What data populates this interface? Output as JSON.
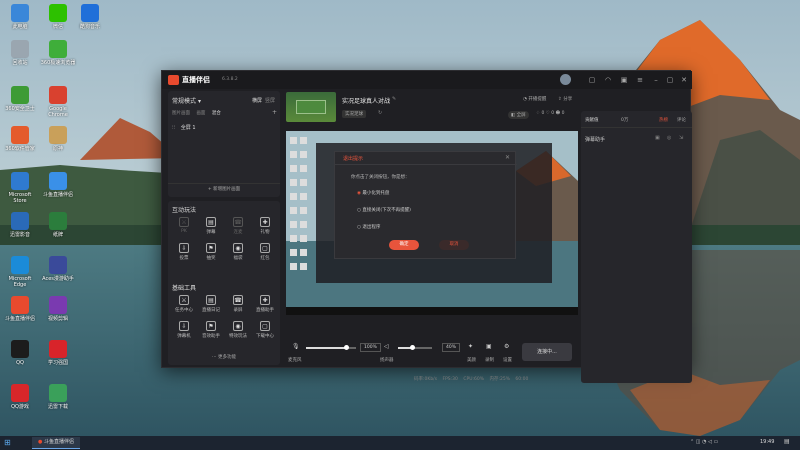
{
  "desktop": {
    "icons": [
      {
        "label": "此电脑",
        "icon": "computer-icon",
        "color": "#3a87d9"
      },
      {
        "label": "微信",
        "icon": "wechat-icon",
        "color": "#2dc100"
      },
      {
        "label": "酷狗音乐",
        "icon": "kugou-icon",
        "color": "#1f6fd9"
      },
      {
        "label": "回收站",
        "icon": "recycle-bin-icon",
        "color": "#9aa6b0"
      },
      {
        "label": "360极速浏览器",
        "icon": "browser-icon",
        "color": "#3fae3a"
      },
      {
        "label": "360安全卫士",
        "icon": "shield-icon",
        "color": "#3d9b35"
      },
      {
        "label": "Google Chrome",
        "icon": "chrome-icon",
        "color": "#d9412f"
      },
      {
        "label": "360软件管家",
        "icon": "store-icon",
        "color": "#e45b2c"
      },
      {
        "label": "原神",
        "icon": "game-icon",
        "color": "#c9a05a"
      },
      {
        "label": "Microsoft Store",
        "icon": "ms-store-icon",
        "color": "#2f7ad0"
      },
      {
        "label": "斗鱼直播伴侣",
        "icon": "douyu-icon",
        "color": "#3a90e8"
      },
      {
        "label": "迅雷影音",
        "icon": "player-icon",
        "color": "#2a6ab8"
      },
      {
        "label": "纸牌",
        "icon": "cards-icon",
        "color": "#2b7d3c"
      },
      {
        "label": "Microsoft Edge",
        "icon": "edge-icon",
        "color": "#1b8bd8"
      },
      {
        "label": "Aces漫游助手",
        "icon": "app-icon",
        "color": "#3a4a9a"
      },
      {
        "label": "斗鱼直播伴侣",
        "icon": "mic-icon",
        "color": "#e84a2e"
      },
      {
        "label": "视频剪辑",
        "icon": "video-icon",
        "color": "#7a3ab0"
      },
      {
        "label": "QQ",
        "icon": "qq-icon",
        "color": "#1c1c1c"
      },
      {
        "label": "学习强国",
        "icon": "study-icon",
        "color": "#d8242a"
      },
      {
        "label": "QQ游戏",
        "icon": "qq-game-icon",
        "color": "#d8262a"
      },
      {
        "label": "迅雷下载",
        "icon": "download-icon",
        "color": "#3aa05a"
      }
    ]
  },
  "app": {
    "title": "直播伴侣",
    "version": "6.3.8.2",
    "mode": {
      "label": "常规模式",
      "selector_icon": "chevron-down-icon",
      "btn_a": "横屏",
      "btn_b": "竖屏"
    },
    "tabs": [
      "图片画面",
      "画面",
      "混合"
    ],
    "scene": {
      "item": "全屏 1"
    },
    "add_scene": "+ 新增图片画面",
    "interact_title": "互动玩法",
    "interact_tools": [
      "PK",
      "弹幕",
      "连麦",
      "礼物",
      "投票",
      "抽奖",
      "福袋",
      "红包"
    ],
    "basic_title": "基础工具",
    "basic_tools": [
      "任务中心",
      "直播日记",
      "录屏",
      "直播助手",
      "弹幕机",
      "音效助手",
      "特效玩法",
      "下载中心"
    ],
    "more_label": "更多功能",
    "stream": {
      "title": "实况足球真人对战",
      "category": "实况足球",
      "right_labels": [
        "开播提醒",
        "分享"
      ]
    },
    "dialog": {
      "title": "退出提示",
      "question": "你点击了关闭按钮，你是想：",
      "options": [
        "最小化到托盘",
        "直接关闭(下次不再提醒)",
        "退出程序"
      ],
      "confirm": "确定",
      "cancel": "取消"
    },
    "controls": {
      "mic_label": "麦克风",
      "mic_volume": "100%",
      "speaker_label": "扬声器",
      "speaker_volume": "40%",
      "beauty_label": "美颜",
      "record_label": "录制",
      "settings_label": "设置",
      "live_button": "连接中..."
    },
    "status": [
      "码率:0Kb/s",
      "FPS:30",
      "CPU:60%",
      "内存:25%",
      "60:00"
    ],
    "right": {
      "tab_a": "贡献值",
      "tab_b": "0万",
      "tab_c": "热榜",
      "tab_d": "评论",
      "assistant": "弹幕助手"
    }
  },
  "taskbar": {
    "task_label": "斗鱼直播伴侣",
    "time": "19:49"
  }
}
